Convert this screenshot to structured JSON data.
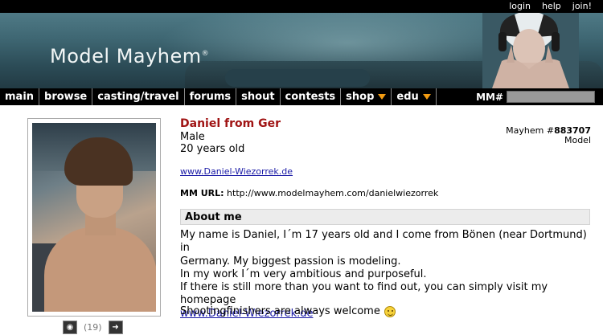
{
  "top_links": [
    "login",
    "help",
    "join!"
  ],
  "brand": {
    "name": "Model Mayhem",
    "mark": "®"
  },
  "nav": {
    "items": [
      {
        "label": "main",
        "dropdown": false
      },
      {
        "label": "browse",
        "dropdown": false
      },
      {
        "label": "casting/travel",
        "dropdown": false
      },
      {
        "label": "forums",
        "dropdown": false
      },
      {
        "label": "shout",
        "dropdown": false
      },
      {
        "label": "contests",
        "dropdown": false
      },
      {
        "label": "shop",
        "dropdown": true
      },
      {
        "label": "edu",
        "dropdown": true
      }
    ],
    "mm_label": "MM#"
  },
  "profile": {
    "name": "Daniel from Ger",
    "gender": "Male",
    "age": "20 years old",
    "mayhem_prefix": "Mayhem #",
    "mayhem_id": "883707",
    "role": "Model",
    "website": "www.Daniel-Wiezorrek.de",
    "mm_url_label": "MM URL:",
    "mm_url": "http://www.modelmayhem.com/danielwiezorrek"
  },
  "photos": {
    "count": "(19)"
  },
  "about": {
    "heading": "About me",
    "line1": "My name is Daniel, I´m 17 years old and I come from Bönen (near Dortmund) in",
    "line2": "Germany. My biggest passion is modeling.",
    "line3": "In my work I´m very ambitious and purposeful.",
    "line4": "If there is still more than you want to find out, you can simply visit my homepage",
    "link": "www.Daniel-Wiezorrek.de",
    "closing": "Shootingfinishers are always welcome"
  },
  "colors": {
    "name_red": "#a01414",
    "nav_arrow": "#f39c12",
    "link_blue": "#1a1aa6"
  }
}
